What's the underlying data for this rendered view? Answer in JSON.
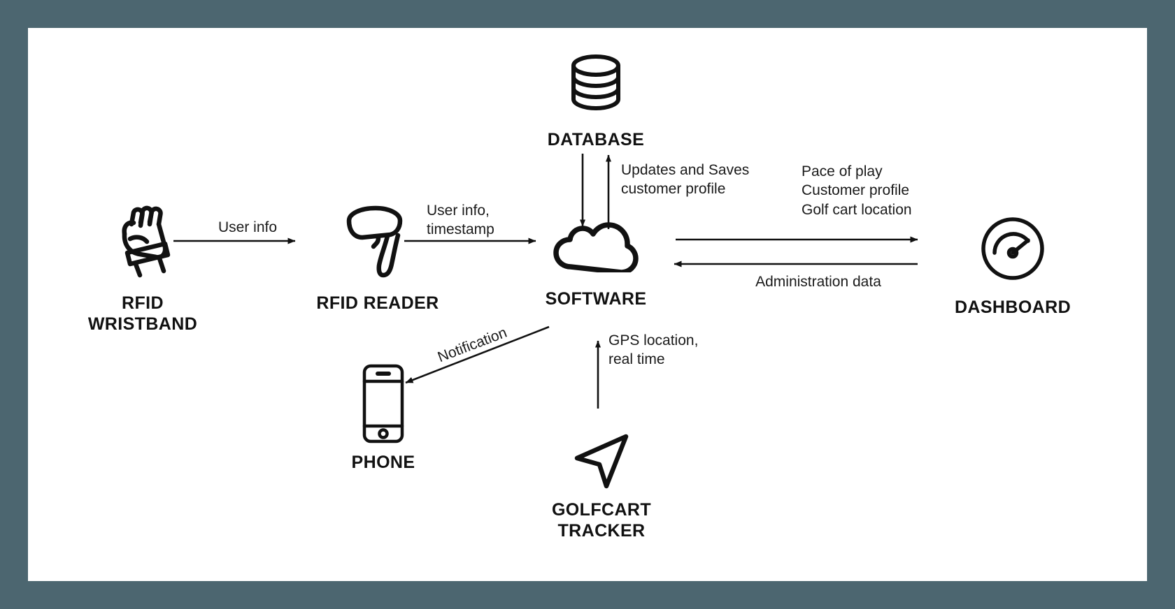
{
  "canvas": {
    "background_color": "#4c6670",
    "page_color": "#ffffff",
    "stroke_color": "#111111"
  },
  "nodes": {
    "rfid_wristband": {
      "label": "RFID\nWRISTBAND",
      "icon": "fist-wristband-icon"
    },
    "rfid_reader": {
      "label": "RFID READER",
      "icon": "barcode-scanner-gun-icon"
    },
    "database": {
      "label": "DATABASE",
      "icon": "database-cylinder-icon"
    },
    "software": {
      "label": "SOFTWARE",
      "icon": "cloud-icon"
    },
    "dashboard": {
      "label": "DASHBOARD",
      "icon": "gauge-icon"
    },
    "phone": {
      "label": "PHONE",
      "icon": "smartphone-icon"
    },
    "golfcart_tracker": {
      "label": "GOLFCART TRACKER",
      "icon": "navigation-arrow-icon"
    }
  },
  "edges": {
    "wristband_to_reader": {
      "label": "User info"
    },
    "reader_to_software": {
      "label": "User info,\ntimestamp"
    },
    "software_database": {
      "label": "Updates and Saves\ncustomer profile"
    },
    "software_to_dashboard": {
      "label": "Pace of play\nCustomer profile\nGolf cart location"
    },
    "dashboard_to_software": {
      "label": "Administration data"
    },
    "software_to_phone": {
      "label": "Notification"
    },
    "tracker_to_software": {
      "label": "GPS location,\nreal time"
    }
  }
}
